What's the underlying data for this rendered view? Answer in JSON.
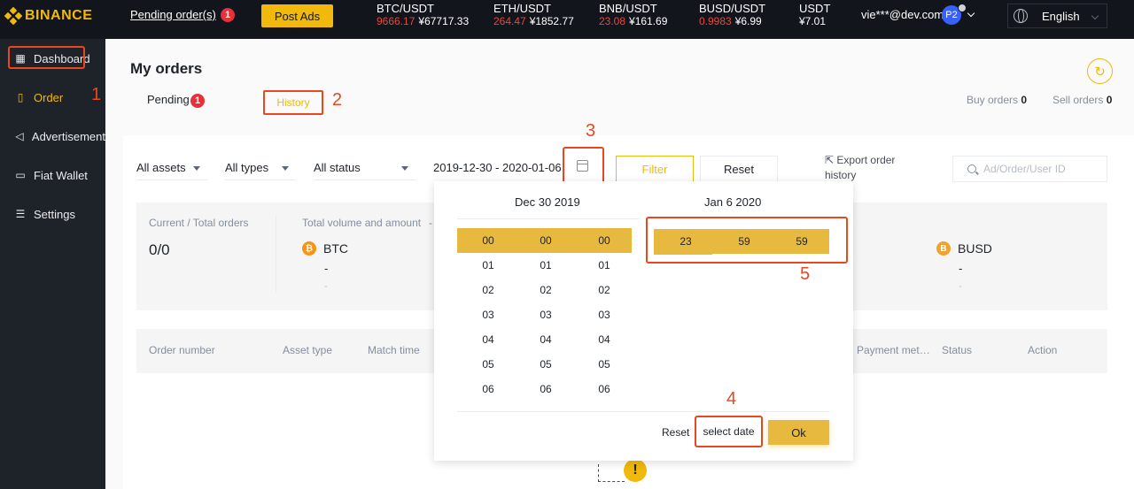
{
  "topbar": {
    "logo_text": "BINANCE",
    "pending_orders_label": "Pending order(s)",
    "pending_orders_count": "1",
    "post_ads_label": "Post Ads",
    "tickers": [
      {
        "pair": "BTC/USDT",
        "price": "9666.17",
        "cny": "¥67717.33"
      },
      {
        "pair": "ETH/USDT",
        "price": "264.47",
        "cny": "¥1852.77"
      },
      {
        "pair": "BNB/USDT",
        "price": "23.08",
        "cny": "¥161.69"
      },
      {
        "pair": "BUSD/USDT",
        "price": "0.9983",
        "cny": "¥6.99"
      },
      {
        "pair": "USDT",
        "price": "",
        "cny": "¥7.01"
      }
    ],
    "email": "vie***@dev.com",
    "avatar": "P2",
    "language": "English"
  },
  "sidebar": {
    "items": [
      {
        "label": "Dashboard",
        "icon": "grid-icon"
      },
      {
        "label": "Order",
        "icon": "document-icon"
      },
      {
        "label": "Advertisement",
        "icon": "megaphone-icon"
      },
      {
        "label": "Fiat Wallet",
        "icon": "wallet-icon"
      },
      {
        "label": "Settings",
        "icon": "sliders-icon"
      }
    ]
  },
  "annotations": {
    "a1": "1",
    "a2": "2",
    "a3": "3",
    "a4": "4",
    "a5": "5"
  },
  "main": {
    "title": "My orders",
    "tabs": {
      "pending": "Pending",
      "pending_count": "1",
      "history": "History"
    },
    "buy_orders_label": "Buy orders",
    "buy_orders_count": "0",
    "sell_orders_label": "Sell orders",
    "sell_orders_count": "0"
  },
  "filters": {
    "assets": "All assets",
    "types": "All types",
    "status": "All status",
    "date_range": "2019-12-30 - 2020-01-06",
    "filter_label": "Filter",
    "reset_label": "Reset",
    "export_label": "Export order history",
    "search_placeholder": "Ad/Order/User ID"
  },
  "stats": {
    "orders_label": "Current / Total orders",
    "orders_value": "0/0",
    "volume_label": "Total volume and amount",
    "volume_suffix": "-",
    "coins": [
      {
        "symbol": "BTC",
        "icon": "bitcoin-icon",
        "value": "-",
        "sub": "-"
      },
      {
        "symbol": "BUSD",
        "icon": "busd-icon",
        "value": "-",
        "sub": "-"
      }
    ]
  },
  "table": {
    "headers": [
      "Order number",
      "Asset type",
      "Match time",
      "Payment met…",
      "Status",
      "Action"
    ]
  },
  "picker": {
    "start_header": "Dec  30  2019",
    "end_header": "Jan  6  2020",
    "start_hours": [
      "00",
      "01",
      "02",
      "03",
      "04",
      "05",
      "06"
    ],
    "start_minutes": [
      "00",
      "01",
      "02",
      "03",
      "04",
      "05",
      "06"
    ],
    "start_seconds": [
      "00",
      "01",
      "02",
      "03",
      "04",
      "05",
      "06"
    ],
    "end_time": {
      "hour": "23",
      "minute": "59",
      "second": "59"
    },
    "reset_label": "Reset",
    "select_date_label": "select date",
    "ok_label": "Ok"
  },
  "colors": {
    "brand": "#f0b90b",
    "annotation": "#e8471f",
    "down": "#e6483d"
  }
}
